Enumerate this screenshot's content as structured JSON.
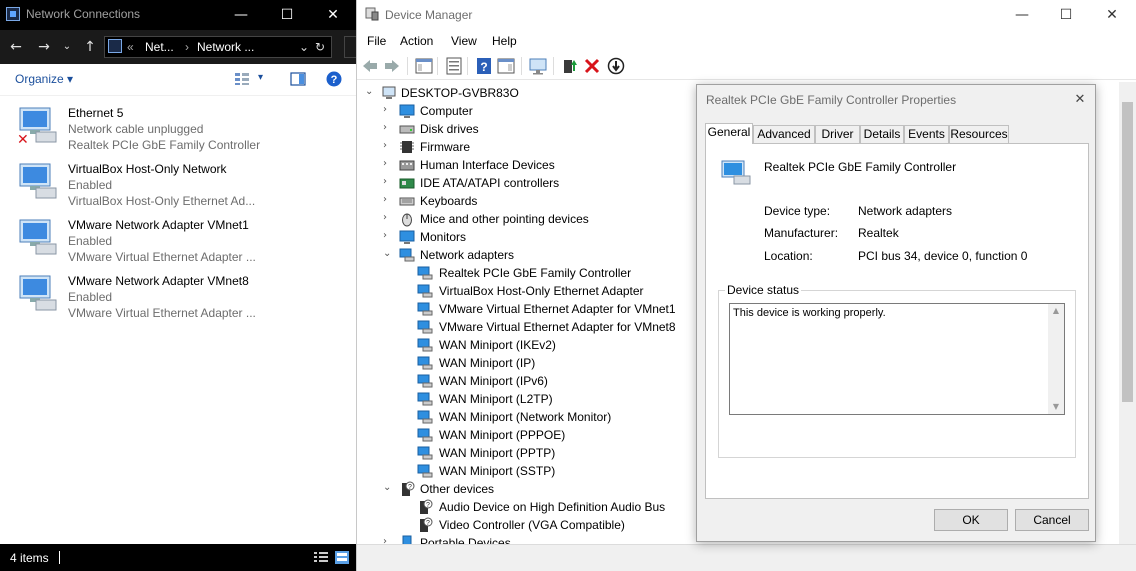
{
  "network_connections": {
    "title": "Network Connections",
    "address": {
      "prefix": "«",
      "part1": "Net...",
      "sep": "›",
      "part2": "Network ..."
    },
    "toolbar": {
      "organize": "Organize"
    },
    "items": [
      {
        "name": "Ethernet 5",
        "status": "Network cable unplugged",
        "device": "Realtek PCIe GbE Family Controller",
        "disconnected": true
      },
      {
        "name": "VirtualBox Host-Only Network",
        "status": "Enabled",
        "device": "VirtualBox Host-Only Ethernet Ad..."
      },
      {
        "name": "VMware Network Adapter VMnet1",
        "status": "Enabled",
        "device": "VMware Virtual Ethernet Adapter ..."
      },
      {
        "name": "VMware Network Adapter VMnet8",
        "status": "Enabled",
        "device": "VMware Virtual Ethernet Adapter ..."
      }
    ],
    "status": {
      "count": "4 items"
    }
  },
  "device_manager": {
    "title": "Device Manager",
    "menu": [
      "File",
      "Action",
      "View",
      "Help"
    ],
    "tree": {
      "root": "DESKTOP-GVBR83O",
      "categories": [
        {
          "label": "Computer"
        },
        {
          "label": "Disk drives"
        },
        {
          "label": "Firmware"
        },
        {
          "label": "Human Interface Devices"
        },
        {
          "label": "IDE ATA/ATAPI controllers"
        },
        {
          "label": "Keyboards"
        },
        {
          "label": "Mice and other pointing devices"
        },
        {
          "label": "Monitors"
        },
        {
          "label": "Network adapters"
        },
        {
          "label": "Other devices"
        },
        {
          "label": "Portable Devices"
        }
      ],
      "network_children": [
        "Realtek PCIe GbE Family Controller",
        "VirtualBox Host-Only Ethernet Adapter",
        "VMware Virtual Ethernet Adapter for VMnet1",
        "VMware Virtual Ethernet Adapter for VMnet8",
        "WAN Miniport (IKEv2)",
        "WAN Miniport (IP)",
        "WAN Miniport (IPv6)",
        "WAN Miniport (L2TP)",
        "WAN Miniport (Network Monitor)",
        "WAN Miniport (PPPOE)",
        "WAN Miniport (PPTP)",
        "WAN Miniport (SSTP)"
      ],
      "other_children": [
        "Audio Device on High Definition Audio Bus",
        "Video Controller (VGA Compatible)"
      ]
    }
  },
  "properties": {
    "title": "Realtek PCIe GbE Family Controller Properties",
    "tabs": [
      "General",
      "Advanced",
      "Driver",
      "Details",
      "Events",
      "Resources"
    ],
    "device_name": "Realtek PCIe GbE Family Controller",
    "device_type_label": "Device type:",
    "device_type": "Network adapters",
    "manufacturer_label": "Manufacturer:",
    "manufacturer": "Realtek",
    "location_label": "Location:",
    "location": "PCI bus 34, device 0, function 0",
    "status_label": "Device status",
    "status_text": "This device is working properly.",
    "ok": "OK",
    "cancel": "Cancel"
  },
  "colors": {
    "accent": "#1b4f9c",
    "dark_bar": "#000000",
    "dialog_bg": "#f0f0f0"
  }
}
